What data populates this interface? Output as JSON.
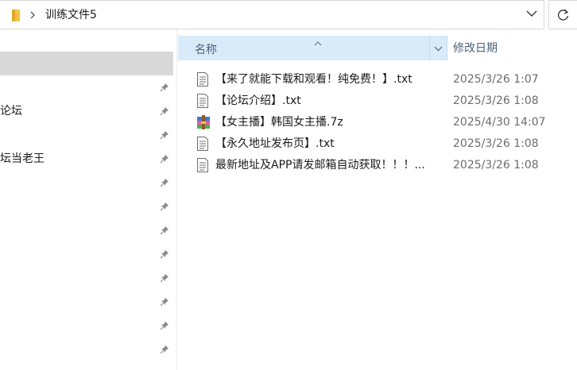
{
  "address": {
    "path": "训练文件5"
  },
  "nav": {
    "items": [
      {
        "label": ""
      },
      {
        "label": "论坛"
      },
      {
        "label": "坛当老王"
      }
    ]
  },
  "columns": {
    "name": "名称",
    "date_modified": "修改日期"
  },
  "files": [
    {
      "name": "【来了就能下载和观看！纯免费！】.txt",
      "date": "2025/3/26 1:07",
      "icon": "text-file-icon"
    },
    {
      "name": "【论坛介绍】.txt",
      "date": "2025/3/26 1:08",
      "icon": "text-file-icon"
    },
    {
      "name": "【女主播】韩国女主播.7z",
      "date": "2025/4/30 14:07",
      "icon": "archive-file-icon"
    },
    {
      "name": "【永久地址发布页】.txt",
      "date": "2025/3/26 1:08",
      "icon": "text-file-icon"
    },
    {
      "name": "最新地址及APP请发邮箱自动获取！！！...",
      "date": "2025/3/26 1:08",
      "icon": "text-file-icon"
    }
  ],
  "colors": {
    "header_bg": "#d9ebf9",
    "selected_nav": "#d9d9d9",
    "folder": "#f5c342"
  }
}
